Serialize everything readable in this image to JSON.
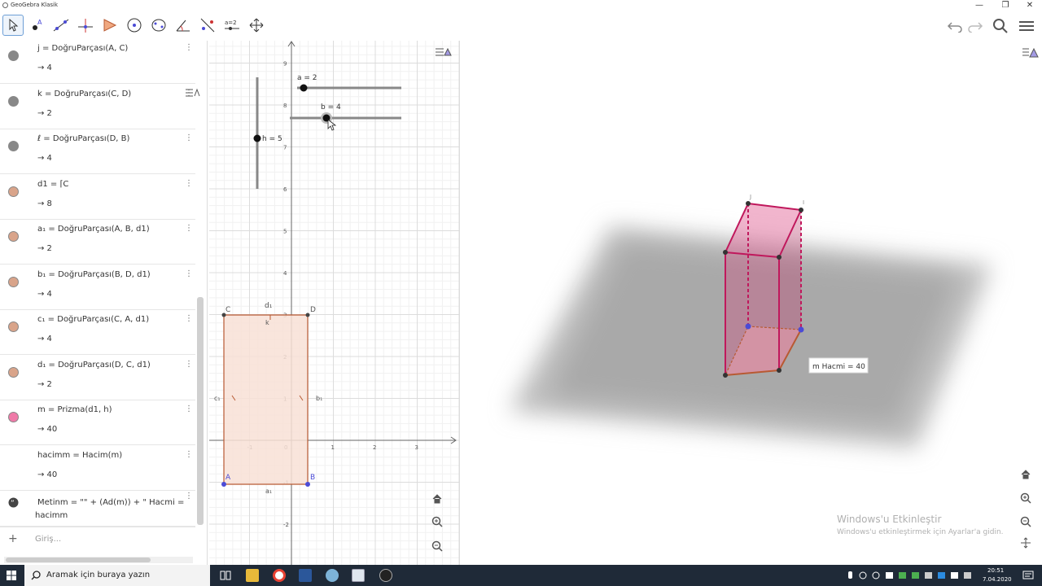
{
  "window": {
    "title": "GeoGebra Klasik",
    "minimize": "—",
    "restore": "❐",
    "close": "✕"
  },
  "colors": {
    "accent": "#6557d2",
    "prism": "#d1457a",
    "rect_fill": "#f8e0d6",
    "rect_stroke": "#b85a33",
    "point_blue": "#4b4bd6",
    "taskbar": "#1f2a38"
  },
  "algebra": {
    "rows": [
      {
        "def": "j = DoğruParçası(A, C)",
        "val": "→  4",
        "dot": "#888888",
        "fill": true
      },
      {
        "def": "k = DoğruParçası(C, D)",
        "val": "→  2",
        "dot": "#888888",
        "fill": true
      },
      {
        "def": "ℓ = DoğruParçası(D, B)",
        "val": "→  4",
        "dot": "#888888",
        "fill": true
      },
      {
        "def": "d1 = ⌈C",
        "val": "→  8",
        "dot": "#d9a48a",
        "fill": true
      },
      {
        "def": "a₁ = DoğruParçası(A, B, d1)",
        "val": "→  2",
        "dot": "#d9a48a",
        "fill": true
      },
      {
        "def": "b₁ = DoğruParçası(B, D, d1)",
        "val": "→  4",
        "dot": "#d9a48a",
        "fill": true
      },
      {
        "def": "c₁ = DoğruParçası(C, A, d1)",
        "val": "→  4",
        "dot": "#d9a48a",
        "fill": true
      },
      {
        "def": "d₁ = DoğruParçası(D, C, d1)",
        "val": "→  2",
        "dot": "#d9a48a",
        "fill": true
      },
      {
        "def": "m = Prizma(d1, h)",
        "val": "→  40",
        "dot": "#ef7aa8",
        "fill": true
      },
      {
        "def": "hacimm = Hacim(m)",
        "val": "→  40",
        "dot": "",
        "fill": false
      }
    ],
    "text_row": {
      "def": "Metinm = \"\" + (Ad(m)) + \" Hacmi =",
      "val": "hacimm"
    },
    "input_placeholder": "Giriş..."
  },
  "sliders": {
    "a": "a = 2",
    "b": "b = 4",
    "h": "h = 5"
  },
  "graphics2d": {
    "x_ticks": [
      "-1",
      "0",
      "1",
      "2",
      "3"
    ],
    "y_ticks": [
      "9",
      "8",
      "7",
      "6",
      "5",
      "4",
      "3",
      "2",
      "1",
      "-1",
      "-2"
    ],
    "points": {
      "A": "A",
      "B": "B",
      "C": "C",
      "D": "D"
    },
    "segment_labels": {
      "k": "k",
      "d1": "d₁",
      "a1": "a₁",
      "b1": "b₁",
      "c1": "c₁"
    }
  },
  "view3d": {
    "volume_label": "m Hacmi = 40",
    "vertex_labels": {
      "top1": "J",
      "top2": "I"
    }
  },
  "watermark": {
    "line1": "Windows'u Etkinleştir",
    "line2": "Windows'u etkinleştirmek için Ayarlar'a gidin."
  },
  "taskbar": {
    "search": "Aramak için buraya yazın",
    "time": "20:51",
    "date": "7.04.2020"
  }
}
